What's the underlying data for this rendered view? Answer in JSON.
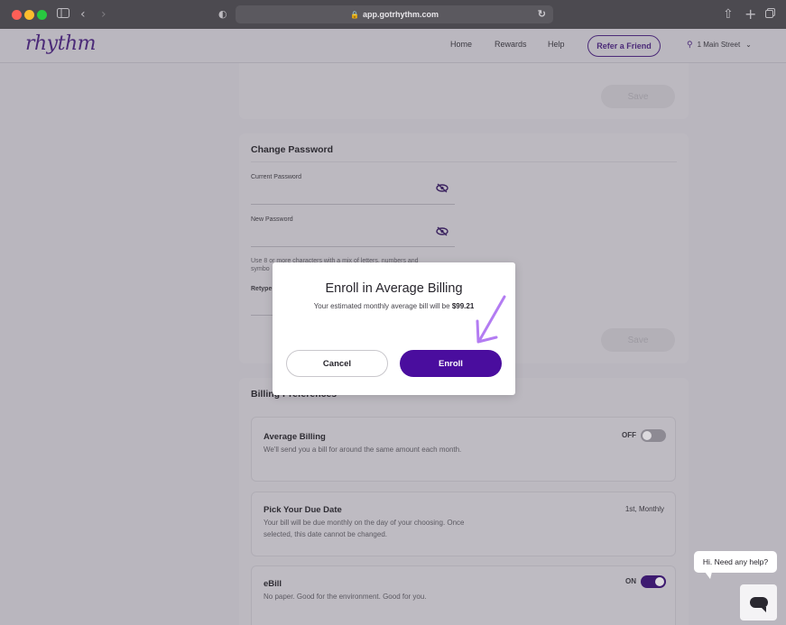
{
  "browser": {
    "url": "app.gotrhythm.com",
    "traffic_colors": [
      "#fe5f57",
      "#febc2e",
      "#28c840"
    ]
  },
  "header": {
    "logo": "rhythm",
    "nav": [
      "Home",
      "Rewards",
      "Help"
    ],
    "refer_label": "Refer a Friend",
    "address": "1 Main Street"
  },
  "top_card": {
    "save_label": "Save"
  },
  "change_password": {
    "title": "Change Password",
    "current_label": "Current Password",
    "new_label": "New Password",
    "help_line1": "Use 8 or more characters with a mix of letters, numbers and",
    "help_line2": "symbo",
    "retype_label": "Retype",
    "save_label": "Save"
  },
  "billing": {
    "title": "Billing Preferences",
    "average": {
      "title": "Average Billing",
      "desc": "We'll send you a bill for around the same amount each month.",
      "toggle_label": "OFF",
      "on": false
    },
    "due_date": {
      "title": "Pick Your Due Date",
      "desc": "Your bill will be due monthly on the day of your choosing. Once selected, this date cannot be changed.",
      "value": "1st, Monthly"
    },
    "ebill": {
      "title": "eBill",
      "desc": "No paper. Good for the environment. Good for you.",
      "toggle_label": "ON",
      "on": true
    }
  },
  "modal": {
    "title": "Enroll in Average Billing",
    "subtitle": "Your estimated monthly average bill will be",
    "amount": "$99.21",
    "cancel_label": "Cancel",
    "enroll_label": "Enroll"
  },
  "chat": {
    "bubble": "Hi. Need any help?"
  },
  "colors": {
    "brand": "#4a0d9e",
    "arrow": "#b37cf2"
  }
}
